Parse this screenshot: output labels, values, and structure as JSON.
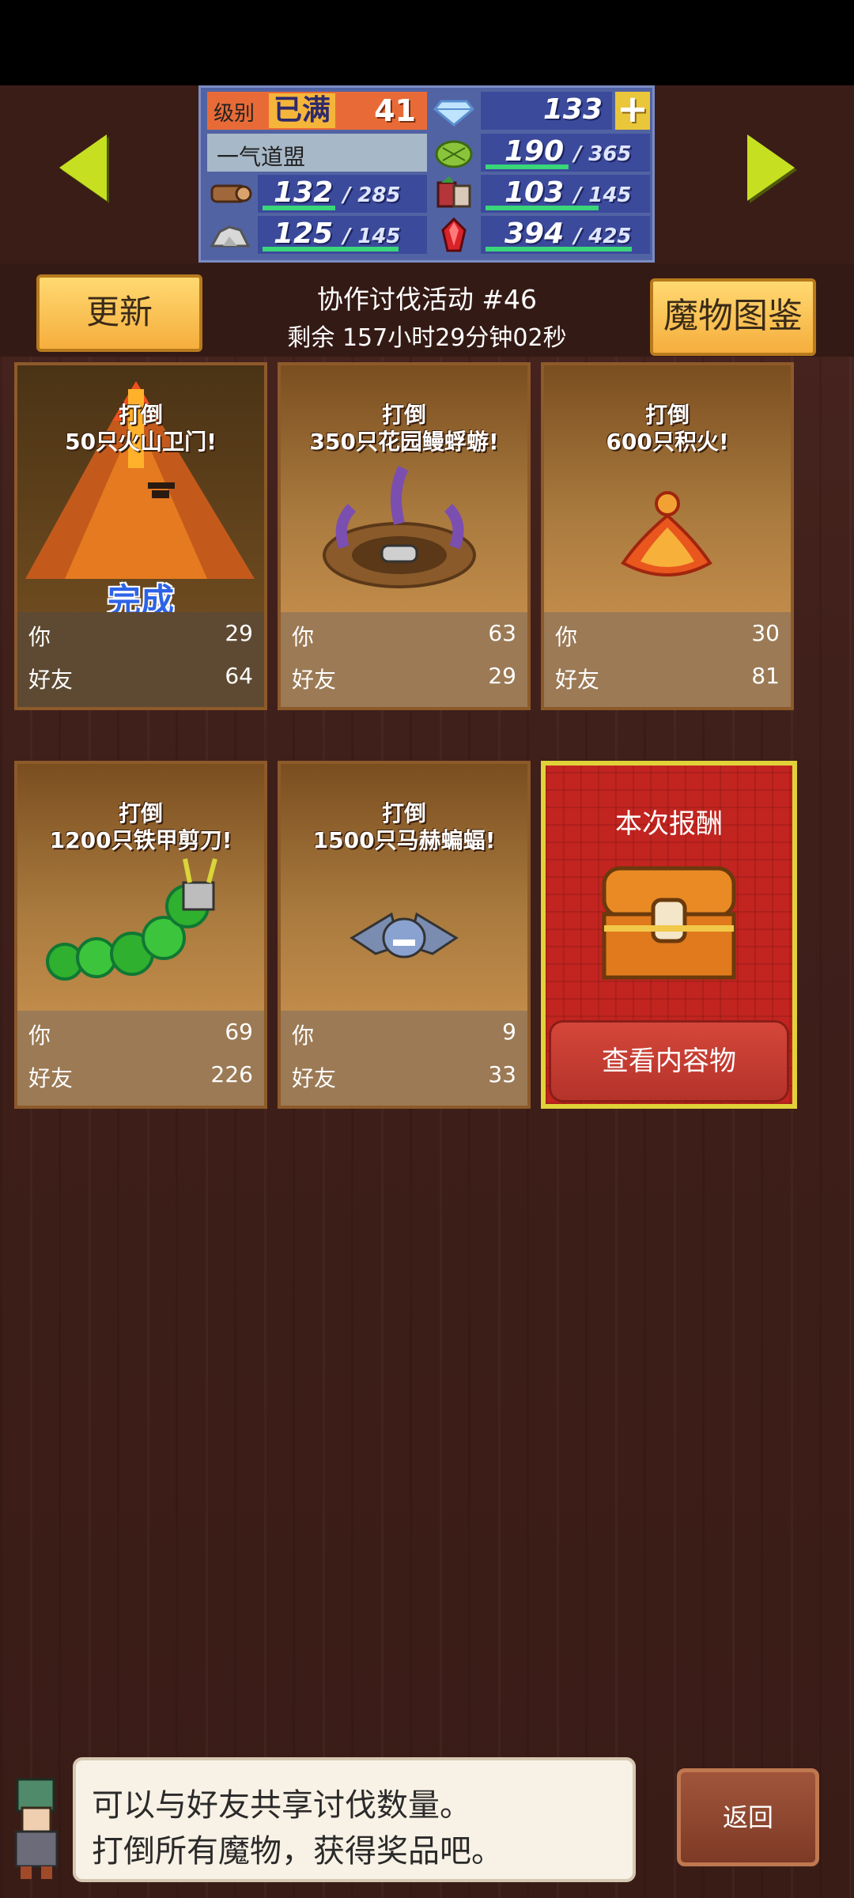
{
  "stats": {
    "level_label": "级别",
    "level_max": "已满",
    "level": "41",
    "gems": "133",
    "guild_name": "一气道盟",
    "grass": {
      "value": "190",
      "max": "/ 365",
      "fill": 0.52
    },
    "wood": {
      "value": "132",
      "max": "/ 285",
      "fill": 0.46
    },
    "food": {
      "value": "103",
      "max": "/ 145",
      "fill": 0.71
    },
    "ore": {
      "value": "125",
      "max": "/ 145",
      "fill": 0.86
    },
    "mana": {
      "value": "394",
      "max": "/ 425",
      "fill": 0.93
    }
  },
  "header": {
    "refresh_label": "更新",
    "title": "协作讨伐活动 #46",
    "countdown": "剩余 157小时29分钟02秒",
    "bestiary_label": "魔物图鉴"
  },
  "cards": [
    {
      "line1": "打倒",
      "line2": "50只火山卫门!",
      "you_label": "你",
      "you": "29",
      "friend_label": "好友",
      "friend": "64",
      "done": "完成"
    },
    {
      "line1": "打倒",
      "line2": "350只花园鳗蜉蝣!",
      "you_label": "你",
      "you": "63",
      "friend_label": "好友",
      "friend": "29"
    },
    {
      "line1": "打倒",
      "line2": "600只积火!",
      "you_label": "你",
      "you": "30",
      "friend_label": "好友",
      "friend": "81"
    },
    {
      "line1": "打倒",
      "line2": "1200只铁甲剪刀!",
      "you_label": "你",
      "you": "69",
      "friend_label": "好友",
      "friend": "226"
    },
    {
      "line1": "打倒",
      "line2": "1500只马赫蝙蝠!",
      "you_label": "你",
      "you": "9",
      "friend_label": "好友",
      "friend": "33"
    }
  ],
  "reward": {
    "title": "本次报酬",
    "view_label": "查看内容物"
  },
  "dialog": {
    "line1": "可以与好友共享讨伐数量。",
    "line2": "打倒所有魔物，获得奖品吧。"
  },
  "back_label": "返回",
  "colors": {
    "accent_gold": "#f5ae3d",
    "arrow": "#c6e021",
    "reward_red": "#c2241f"
  }
}
